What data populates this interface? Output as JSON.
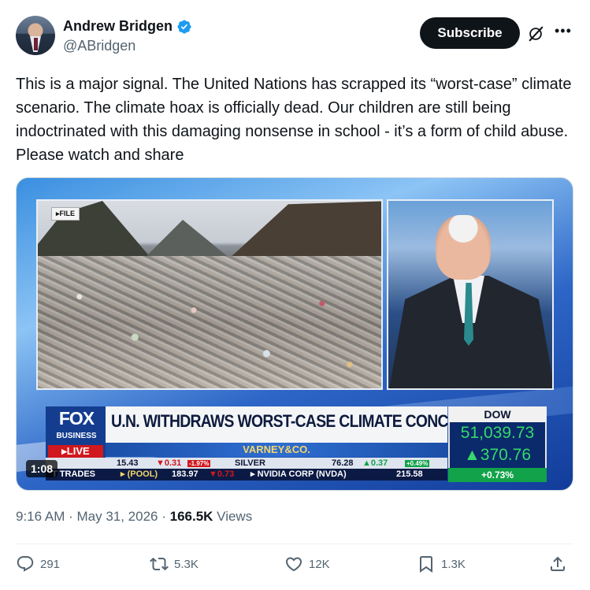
{
  "author": {
    "display_name": "Andrew Bridgen",
    "handle": "@ABridgen",
    "verified": true,
    "verified_color": "#1d9bf0"
  },
  "header_actions": {
    "subscribe_label": "Subscribe",
    "grok_icon": "grok-icon",
    "more_icon": "more-icon"
  },
  "tweet": {
    "text": "This is a major signal.  The United Nations has scrapped its “worst-case” climate scenario. The climate hoax is officially dead.  Our children are still being indoctrinated with this damaging nonsense in school - it’s a form of child abuse.  Please watch and share"
  },
  "video": {
    "duration": "1:08",
    "file_tag": "▸FILE",
    "logo": "FOX",
    "logo_sub": "BUSINESS",
    "live": "▸LIVE",
    "headline": "U.N. WITHDRAWS WORST-CASE CLIMATE CONCLUSION",
    "show_name": "VARNEY&CO.",
    "ticker_top": {
      "a": "15.43",
      "b": "▼0.31",
      "c": "-1.97%",
      "d": "SILVER",
      "e": "76.28",
      "f": "▲0.37",
      "g": "+0.49%"
    },
    "ticker_bottom": {
      "a": "T TRADES",
      "b": "▸ (POOL)",
      "c": "183.97",
      "d": "▼0.73",
      "e": "▸ NVIDIA CORP (NVDA)",
      "f": "215.58"
    },
    "dow": {
      "label": "DOW",
      "value": "51,039.73",
      "change": "▲370.76",
      "pct": "+0.73%"
    }
  },
  "meta": {
    "time": "9:16 AM",
    "separator1": " · ",
    "date": "May 31, 2026",
    "separator2": " · ",
    "views_count": "166.5K",
    "views_label": " Views"
  },
  "actions": {
    "replies": "291",
    "reposts": "5.3K",
    "likes": "12K",
    "bookmarks": "1.3K"
  }
}
